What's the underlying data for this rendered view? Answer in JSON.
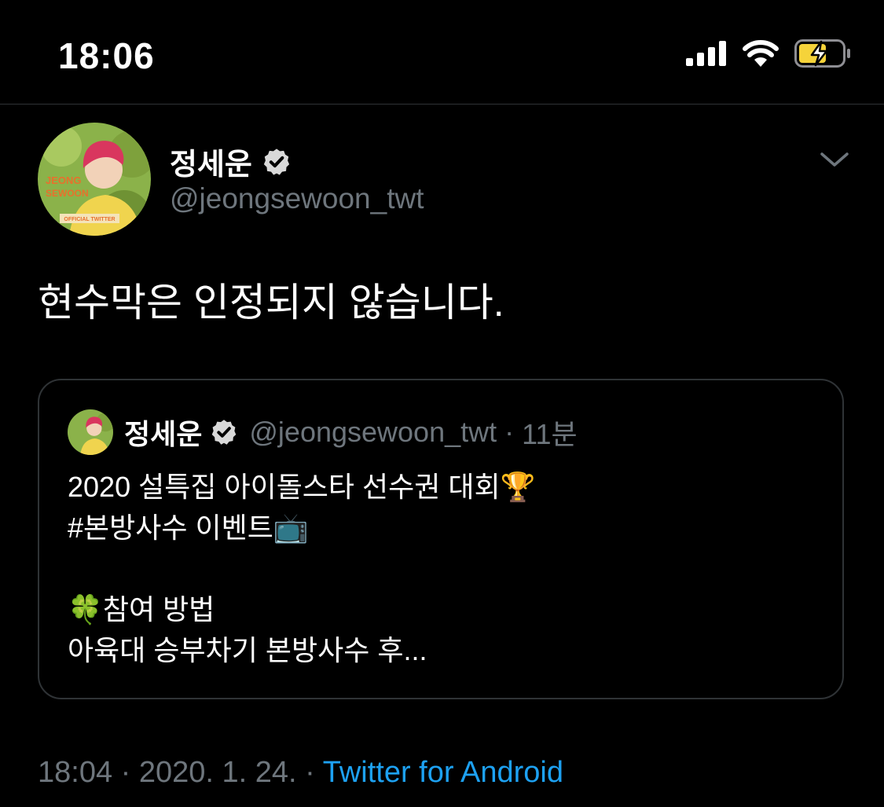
{
  "status_bar": {
    "time": "18:06",
    "icons": [
      "signal-icon",
      "wifi-icon",
      "battery-charging-icon"
    ]
  },
  "tweet": {
    "author": {
      "display_name": "정세운",
      "handle": "@jeongsewoon_twt",
      "avatar_text": [
        "JEONG",
        "SEWOON",
        "OFFICIAL TWITTER"
      ]
    },
    "text": "현수막은 인정되지 않습니다.",
    "quoted": {
      "display_name": "정세운",
      "handle": "@jeongsewoon_twt",
      "separator": "·",
      "time": "11분",
      "body": "2020 설특집 아이돌스타 선수권 대회🏆\n#본방사수 이벤트📺\n\n🍀참여 방법\n아육대 승부차기 본방사수 후..."
    },
    "meta": {
      "time": "18:04",
      "sep1": "·",
      "date": "2020. 1. 24.",
      "sep2": "·",
      "source": "Twitter for Android"
    }
  },
  "colors": {
    "background": "#000000",
    "secondary_text": "#6e767d",
    "link": "#1da1f2",
    "border": "#2f3336",
    "battery": "#f5d33a"
  }
}
